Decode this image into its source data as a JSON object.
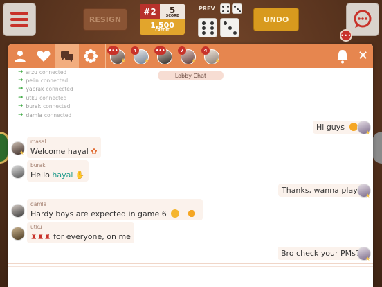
{
  "game_bar": {
    "resign_label": "RESIGN",
    "rank": "#2",
    "score_value": "5",
    "score_label": "SCORE",
    "credit_value": "1,500",
    "credit_label": "CREDIT",
    "prev_label": "PREV",
    "undo_label": "UNDO",
    "chat_badge": "•••"
  },
  "colors": {
    "accent_orange": "#e6864f",
    "active_tab": "#f2ad7e",
    "badge_red": "#c8322a",
    "mention_teal": "#1e9a8a",
    "connected_green": "#4caf50"
  },
  "tabs": [
    {
      "icon": "person-icon"
    },
    {
      "icon": "heart-icon"
    },
    {
      "icon": "chat-bubbles-icon",
      "active": true
    },
    {
      "icon": "gear-flower-icon"
    }
  ],
  "open_chats": [
    {
      "badge": "•••",
      "star": true
    },
    {
      "badge": "4",
      "star": true
    },
    {
      "badge": "•••",
      "star": false
    },
    {
      "badge": "7",
      "star": true
    },
    {
      "badge": "4",
      "star": true
    }
  ],
  "lobby_label": "Lobby Chat",
  "connections": [
    {
      "name": "arzu",
      "status": "connected"
    },
    {
      "name": "pelin",
      "status": "connected"
    },
    {
      "name": "yaprak",
      "status": "connected"
    },
    {
      "name": "utku",
      "status": "connected"
    },
    {
      "name": "burak",
      "status": "connected"
    },
    {
      "name": "damla",
      "status": "connected"
    }
  ],
  "messages": [
    {
      "side": "right",
      "text": "Hi guys"
    },
    {
      "side": "left",
      "sender": "masal",
      "text": "Welcome hayal"
    },
    {
      "side": "left",
      "sender": "burak",
      "text": "Hello",
      "mention": "hayal"
    },
    {
      "side": "right",
      "text": "Thanks, wanna play?"
    },
    {
      "side": "left",
      "sender": "damla",
      "text": "Hardy boys are expected in game 6"
    },
    {
      "side": "left",
      "sender": "utku",
      "text": "for everyone, on me"
    },
    {
      "side": "right",
      "text": "Bro check your PMs?"
    }
  ]
}
